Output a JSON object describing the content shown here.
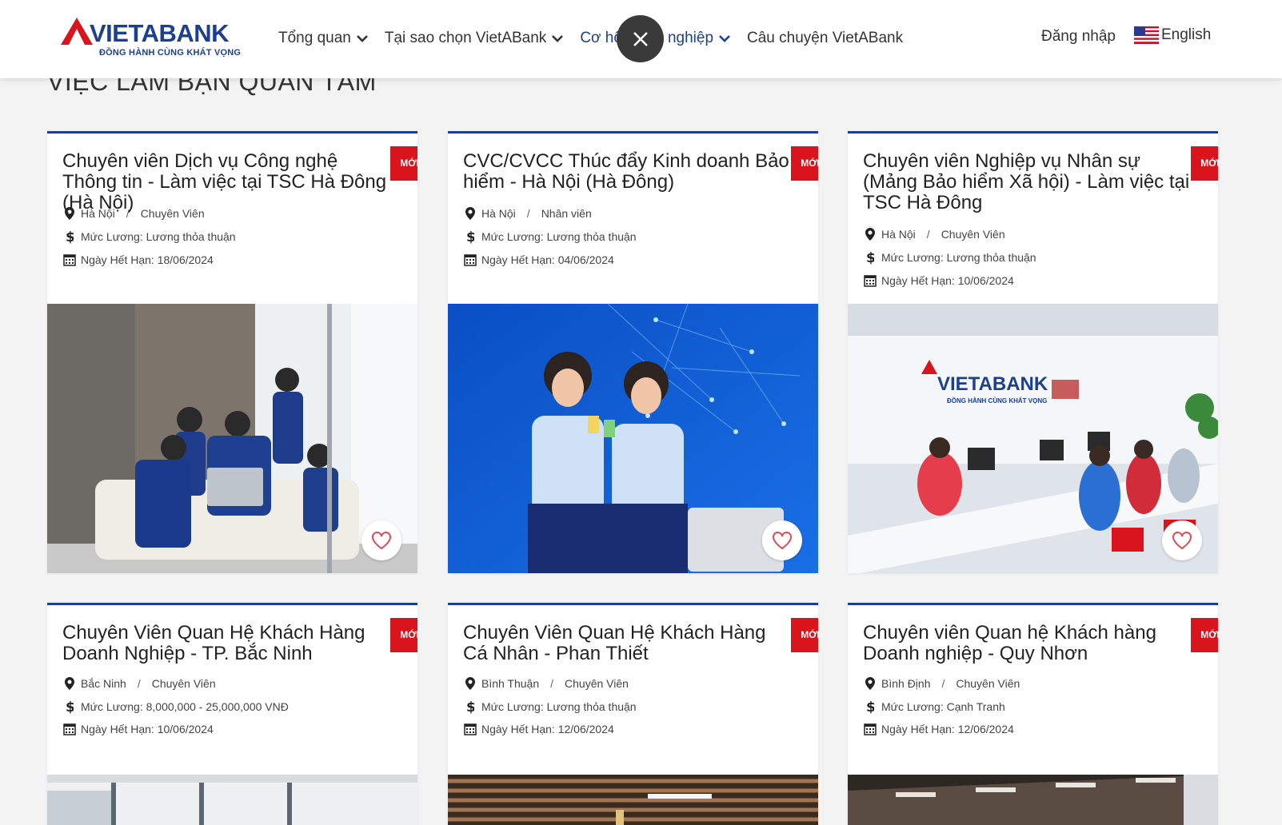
{
  "header": {
    "logo_text": "VIETABANK",
    "logo_slogan": "ĐỒNG HÀNH CÙNG KHÁT VỌNG",
    "nav": [
      {
        "label": "Tổng quan",
        "has_dropdown": true
      },
      {
        "label": "Tại sao chọn VietABank",
        "has_dropdown": true
      },
      {
        "label": "Cơ hội nghề nghiệp",
        "has_dropdown": true,
        "active": true
      },
      {
        "label": "Câu chuyện VietABank",
        "has_dropdown": false
      }
    ],
    "login_label": "Đăng nhập",
    "language_label": "English"
  },
  "section_title": "VIỆC LÀM BẠN QUAN TÂM",
  "badge_label": "MỚI",
  "jobs": [
    {
      "title": "Chuyên viên Dịch vụ Công nghệ Thông tin - Làm việc tại TSC Hà Đông (Hà Nội)",
      "location": "Hà Nội",
      "level": "Chuyên Viên",
      "salary": "Mức Lương: Lương thỏa thuận",
      "deadline": "Ngày Hết Hạn: 18/06/2024"
    },
    {
      "title": "CVC/CVCC Thúc đẩy Kinh doanh Bảo hiểm - Hà Nội (Hà Đông)",
      "location": "Hà Nội",
      "level": "Nhân viên",
      "salary": "Mức Lương: Lương thỏa thuận",
      "deadline": "Ngày Hết Hạn: 04/06/2024"
    },
    {
      "title": "Chuyên viên Nghiệp vụ Nhân sự (Mảng Bảo hiểm Xã hội) - Làm việc tại TSC Hà Đông",
      "location": "Hà Nội",
      "level": "Chuyên Viên",
      "salary": "Mức Lương: Lương thỏa thuận",
      "deadline": "Ngày Hết Hạn: 10/06/2024"
    },
    {
      "title": "Chuyên Viên Quan Hệ Khách Hàng Doanh Nghiệp - TP. Bắc Ninh",
      "location": "Bắc Ninh",
      "level": "Chuyên Viên",
      "salary": "Mức Lương: 8,000,000 - 25,000,000 VNĐ",
      "deadline": "Ngày Hết Hạn: 10/06/2024"
    },
    {
      "title": "Chuyên Viên Quan Hệ Khách Hàng Cá Nhân - Phan Thiết",
      "location": "Bình Thuận",
      "level": "Chuyên Viên",
      "salary": "Mức Lương: Lương thỏa thuận",
      "deadline": "Ngày Hết Hạn: 12/06/2024"
    },
    {
      "title": "Chuyên viên Quan hệ Khách hàng Doanh nghiệp - Quy Nhơn",
      "location": "Bình Định",
      "level": "Chuyên Viên",
      "salary": "Mức Lương: Cạnh Tranh",
      "deadline": "Ngày Hết Hạn: 12/06/2024"
    }
  ],
  "photo_logo_text": "VIETABANK",
  "photo_logo_slogan": "ĐỒNG HÀNH CÙNG KHÁT VỌNG",
  "colors": {
    "brand_blue": "#1d3f8f",
    "brand_red": "#d9141c",
    "page_bg": "#f3f3f3"
  }
}
